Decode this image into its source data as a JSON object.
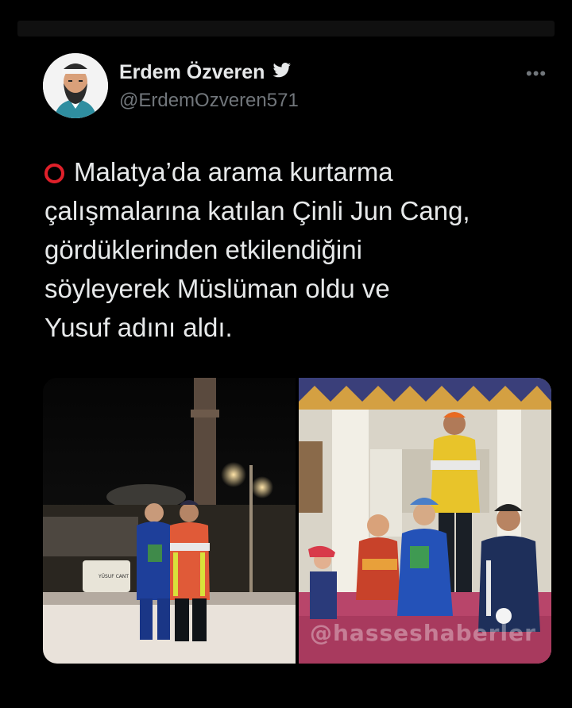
{
  "tweet": {
    "author_name": "Erdem Özveren",
    "author_handle": "@ErdemOzveren571",
    "more_label": "•••",
    "lines": [
      "Malatya’da arama kurtarma",
      "çalışmalarına katılan Çinli Jun Cang,",
      "gördüklerinden etkilendiğini",
      "söyleyerek Müslüman oldu ve",
      "Yusuf adını aldı."
    ],
    "leading_icon": "red-hollow-circle-emoji"
  },
  "media": {
    "watermark": "@hasseshaberler",
    "sign_text": "YÜSUF CANT"
  },
  "icons": {
    "verified_bird": "twitter-bird-icon",
    "more": "more-dots-icon"
  },
  "colors": {
    "background": "#000000",
    "name": "#e7e9ea",
    "handle": "#71767b",
    "accent_red": "#e0202a"
  }
}
